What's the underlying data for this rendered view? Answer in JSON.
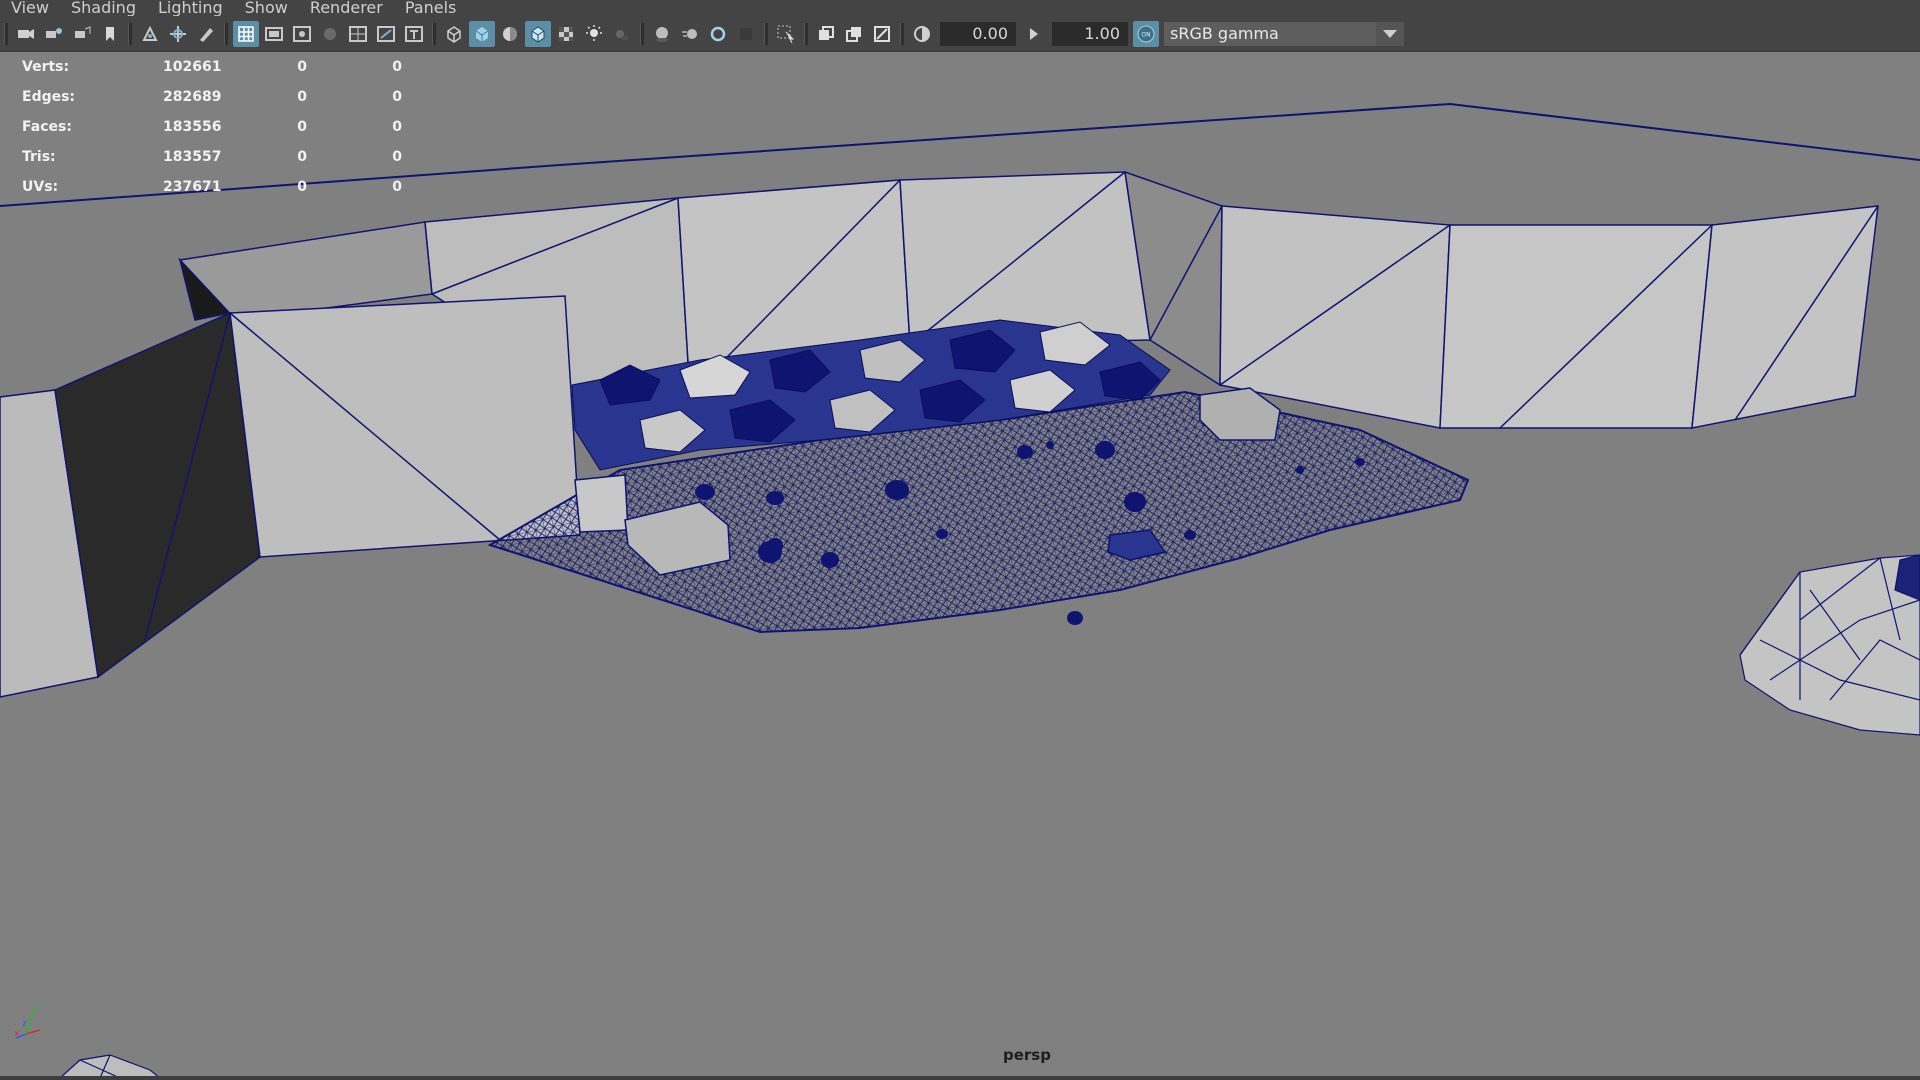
{
  "menu": [
    "View",
    "Shading",
    "Lighting",
    "Show",
    "Renderer",
    "Panels"
  ],
  "toolbar": {
    "exposure_value": "0.00",
    "gamma_value": "1.00",
    "colorspace_toggle": "ON",
    "colorspace": "sRGB gamma"
  },
  "hud": {
    "rows": [
      {
        "label": "Verts:",
        "value": "102661",
        "selected": "0",
        "extra": "0"
      },
      {
        "label": "Edges:",
        "value": "282689",
        "selected": "0",
        "extra": "0"
      },
      {
        "label": "Faces:",
        "value": "183556",
        "selected": "0",
        "extra": "0"
      },
      {
        "label": "Tris:",
        "value": "183557",
        "selected": "0",
        "extra": "0"
      },
      {
        "label": "UVs:",
        "value": "237671",
        "selected": "0",
        "extra": "0"
      }
    ]
  },
  "camera": "persp",
  "axis": {
    "x": "x",
    "y": "y",
    "z": "z"
  },
  "colors": {
    "ui_bg": "#444444",
    "viewport_bg": "#808080",
    "wireframe": "#0e1470",
    "active_icon": "#5a8fa6"
  }
}
